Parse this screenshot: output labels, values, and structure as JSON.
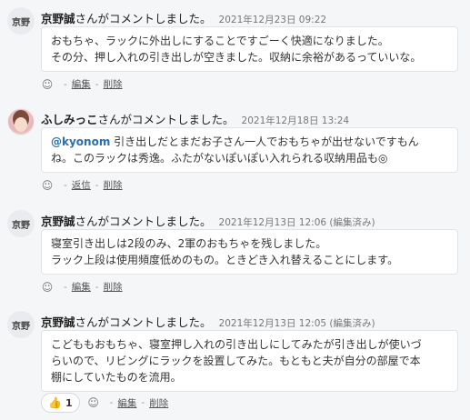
{
  "comments": [
    {
      "avatar_text": "京野",
      "user": "京野誠",
      "action": "さんがコメントしました。",
      "time": "2021年12月23日 09:22",
      "lines": [
        "おもちゃ、ラックに外出しにすることですごーく快適になりました。",
        "その分、押し入れの引き出しが空きました。収納に余裕があるっていいな。"
      ],
      "links": [
        "編集",
        "削除"
      ]
    },
    {
      "avatar_text": "",
      "user": "ふしみっこ",
      "action": "さんがコメントしました。",
      "time": "2021年12月18日 13:24",
      "mention": "@kyonom",
      "line1_rest": " 引き出しだとまだお子さん一人でおもちゃが出せないですもん",
      "line2": "ね。このラックは秀逸。ふたがないぽいぽい入れられる収納用品も◎",
      "links": [
        "返信",
        "削除"
      ]
    },
    {
      "avatar_text": "京野",
      "user": "京野誠",
      "action": "さんがコメントしました。",
      "time": "2021年12月13日 12:06 (編集済み)",
      "lines": [
        "寝室引き出しは2段のみ、2軍のおもちゃを残しました。",
        "ラック上段は使用頻度低めのもの。ときどき入れ替えることにします。"
      ],
      "links": [
        "編集",
        "削除"
      ]
    },
    {
      "avatar_text": "京野",
      "user": "京野誠",
      "action": "さんがコメントしました。",
      "time": "2021年12月13日 12:05 (編集済み)",
      "lines": [
        "こどももおもちゃ、寝室押し入れの引き出しにしてみたが引き出しが使いづ",
        "らいので、リビングにラックを設置してみた。もともと夫が自分の部屋で本",
        "棚にしていたものを流用。"
      ],
      "reaction_count": "1",
      "links": [
        "編集",
        "削除"
      ]
    }
  ],
  "icons": {
    "emoji_add": "smile-plus-icon",
    "thumbs_up": "thumbs-up-icon"
  },
  "colors": {
    "mention": "#2a6fb5",
    "background": "#f5f6f8"
  }
}
